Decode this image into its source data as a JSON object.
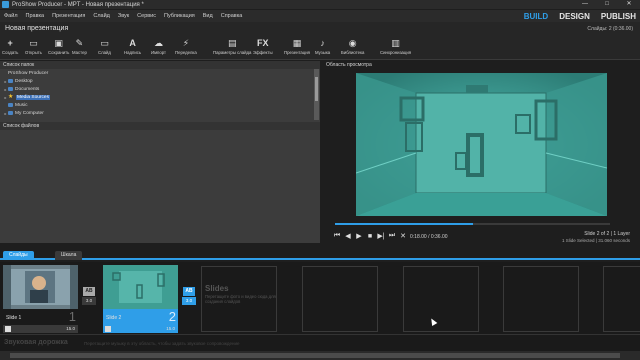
{
  "window": {
    "title": "ProShow Producer - MPT - Новая презентация *",
    "controls": [
      "—",
      "□",
      "✕"
    ]
  },
  "menu": [
    "Файл",
    "Правка",
    "Презентация",
    "Слайд",
    "Звук",
    "Сервис",
    "Публикация",
    "Вид",
    "Справка"
  ],
  "modes": [
    "BUILD",
    "DESIGN",
    "PUBLISH"
  ],
  "project": {
    "title": "Новая презентация",
    "slides_info": "Слайды: 2 (0:36.00)"
  },
  "toolbar": [
    {
      "label": "Создать",
      "icon": "new-icon",
      "glyph": "+"
    },
    {
      "label": "Открыть",
      "icon": "open-icon",
      "glyph": "▭"
    },
    {
      "label": "Сохранить",
      "icon": "save-icon",
      "glyph": "▣"
    },
    {
      "label": "Мастер",
      "icon": "wizard-icon",
      "glyph": "✎"
    },
    {
      "label": "Слайд",
      "icon": "slide-icon",
      "glyph": "▭"
    },
    {
      "label": "Надпись",
      "icon": "caption-icon",
      "glyph": "A"
    },
    {
      "label": "Импорт",
      "icon": "import-icon",
      "glyph": "☁"
    },
    {
      "label": "Переделка",
      "icon": "remix-icon",
      "glyph": "⚡"
    },
    {
      "label": "Параметры слайда",
      "icon": "slide-options-icon",
      "glyph": "▤"
    },
    {
      "label": "Эффекты",
      "icon": "effects-icon",
      "glyph": "FX"
    },
    {
      "label": "Презентация",
      "icon": "show-options-icon",
      "glyph": "▦"
    },
    {
      "label": "Музыка",
      "icon": "music-icon",
      "glyph": "♪"
    },
    {
      "label": "Библиотека",
      "icon": "library-icon",
      "glyph": "◉"
    },
    {
      "label": "Синхронизация",
      "icon": "sync-icon",
      "glyph": "▥"
    }
  ],
  "folders": {
    "header": "Список папок",
    "items": [
      {
        "label": "ProShow Producer",
        "icon": "none",
        "caret": ""
      },
      {
        "label": "Desktop",
        "icon": "folder",
        "caret": "▸"
      },
      {
        "label": "Documents",
        "icon": "folder",
        "caret": "▸"
      },
      {
        "label": "Media Sources",
        "icon": "star",
        "caret": "▸"
      },
      {
        "label": "Music",
        "icon": "folder",
        "caret": ""
      },
      {
        "label": "My Computer",
        "icon": "folder",
        "caret": "▸"
      }
    ]
  },
  "files": {
    "header": "Список файлов"
  },
  "preview": {
    "header": "Область просмотра",
    "progress": 0.5,
    "time": "0:18.00 / 0:36.00",
    "slide_counter": "Slide 2 of 2  |  1 Layer",
    "slide_selected": "1 Slide Selected  |  31.060 seconds",
    "controls": [
      "⏮",
      "◀",
      "▶",
      "■",
      "▶|",
      "⏭",
      "✕"
    ]
  },
  "timeline": {
    "tabs": [
      "Слайды",
      "Шкала"
    ],
    "slides": [
      {
        "name": "Slide 1",
        "number": "1",
        "duration": "15.0",
        "transition": "3.0"
      },
      {
        "name": "Slide 2",
        "number": "2",
        "duration": "15.0",
        "transition": "3.0"
      }
    ],
    "hint_title": "Slides",
    "hint_text": "Перетащите фото и видео сюда для создания слайдов",
    "soundtrack_title": "Звуковая дорожка",
    "soundtrack_hint": "Перетащите музыку в эту область, чтобы задать звуковое сопровождение"
  },
  "colors": {
    "accent": "#2f9ee8",
    "preview": "#43a79c"
  }
}
